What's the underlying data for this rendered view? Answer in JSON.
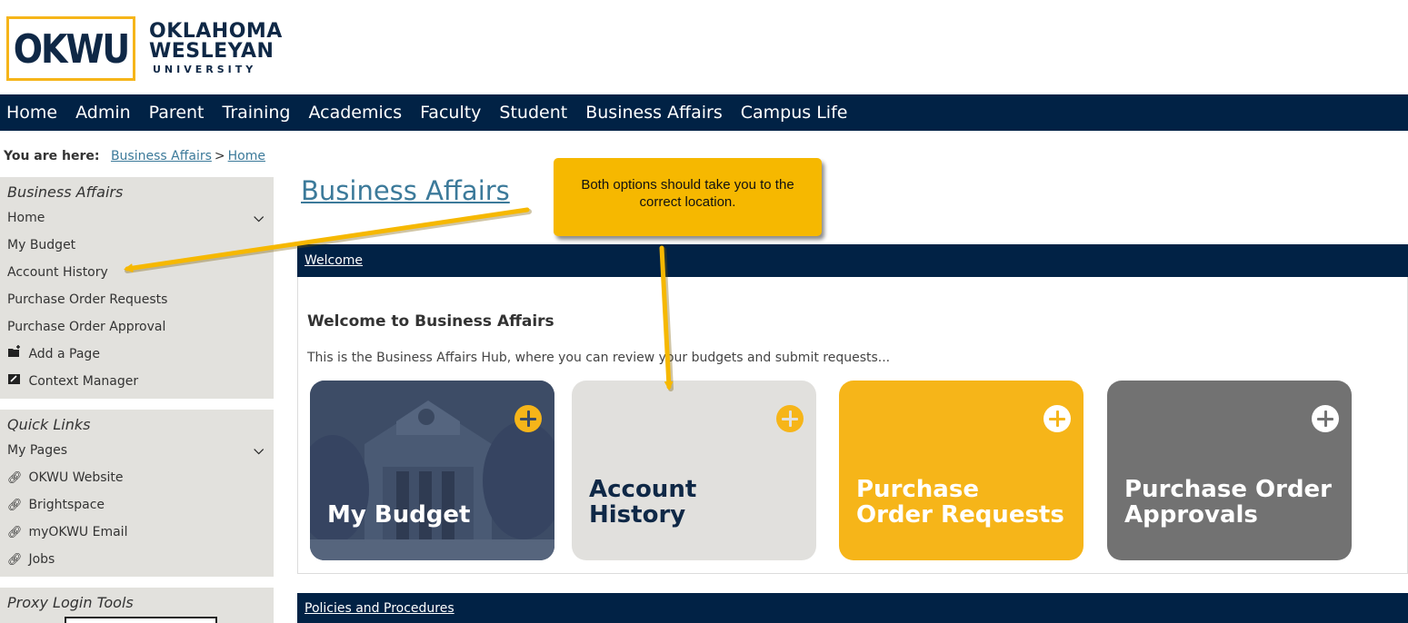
{
  "logo": {
    "mark": "OKWU",
    "line1": "OKLAHOMA",
    "line2": "WESLEYAN",
    "line3": "UNIVERSITY"
  },
  "topnav": [
    "Home",
    "Admin",
    "Parent",
    "Training",
    "Academics",
    "Faculty",
    "Student",
    "Business Affairs",
    "Campus Life"
  ],
  "breadcrumb": {
    "label": "You are here:",
    "crumbs": [
      "Business Affairs",
      "Home"
    ],
    "separator": ">"
  },
  "sidebar": {
    "sections": [
      {
        "title": "Business Affairs",
        "items": [
          {
            "label": "Home",
            "icon": "",
            "expandable": true
          },
          {
            "label": "My Budget",
            "icon": ""
          },
          {
            "label": "Account History",
            "icon": ""
          },
          {
            "label": "Purchase Order Requests",
            "icon": ""
          },
          {
            "label": "Purchase Order Approval",
            "icon": ""
          },
          {
            "label": "Add a Page",
            "icon": "add-page-icon"
          },
          {
            "label": "Context Manager",
            "icon": "context-manager-icon"
          }
        ]
      },
      {
        "title": "Quick Links",
        "items": [
          {
            "label": "My Pages",
            "icon": "",
            "expandable": true
          },
          {
            "label": "OKWU Website",
            "icon": "link-icon"
          },
          {
            "label": "Brightspace",
            "icon": "link-icon"
          },
          {
            "label": "myOKWU Email",
            "icon": "link-icon"
          },
          {
            "label": "Jobs",
            "icon": "link-icon"
          }
        ]
      },
      {
        "title": "Proxy Login Tools",
        "items": []
      }
    ]
  },
  "main": {
    "page_title": "Business Affairs",
    "welcome_bar": "Welcome",
    "welcome_heading": "Welcome to Business Affairs",
    "welcome_desc": "This is the Business Affairs Hub, where you can review your budgets and submit requests...",
    "tiles": [
      {
        "line1": "My Budget",
        "line2": ""
      },
      {
        "line1": "Account",
        "line2": "History"
      },
      {
        "line1": "Purchase",
        "line2": "Order Requests"
      },
      {
        "line1": "Purchase Order",
        "line2": "Approvals"
      }
    ],
    "policies_bar": "Policies and Procedures"
  },
  "annotation": {
    "callout_text": "Both options should take you to the correct location.",
    "color": "#f6b800"
  },
  "colors": {
    "navy": "#012245",
    "gold": "#f6b519",
    "link": "#3c7a9a",
    "sidebar_bg": "#e2e1dd"
  }
}
